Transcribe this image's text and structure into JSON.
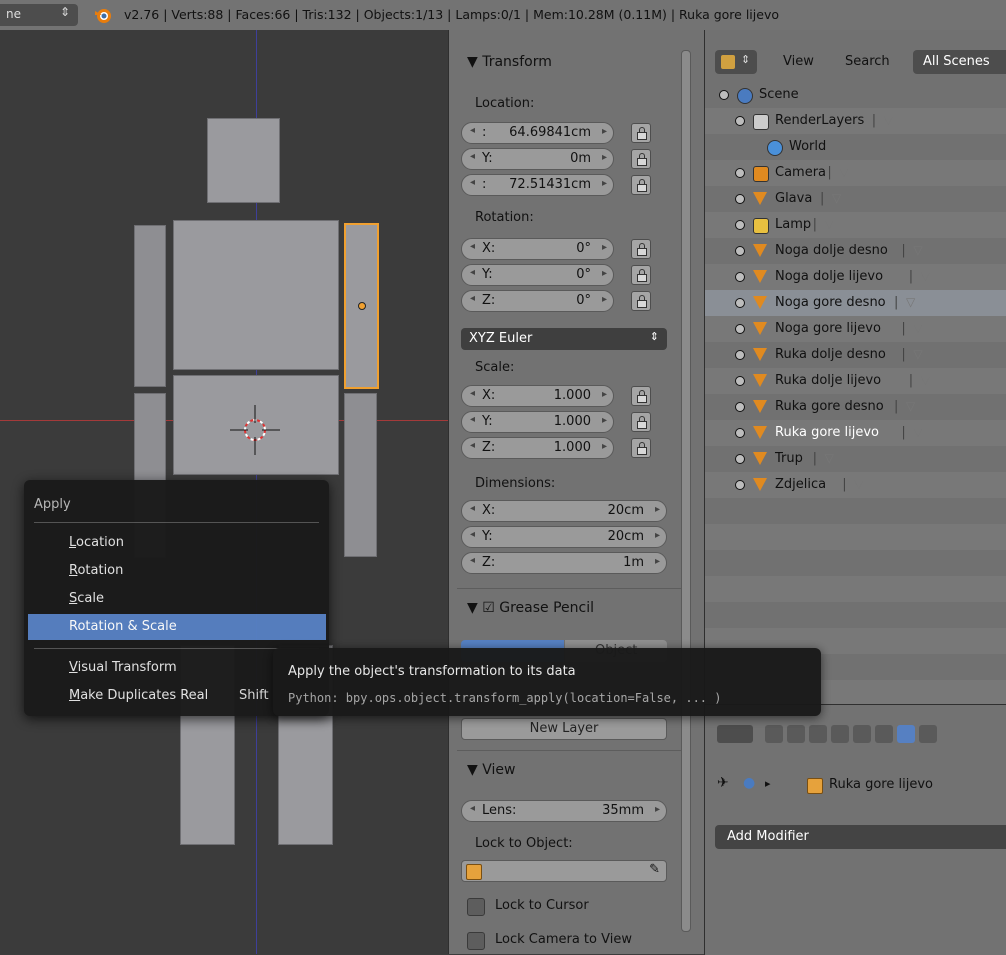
{
  "header": {
    "scene_selector": "ne",
    "stats": "v2.76 | Verts:88 | Faces:66 | Tris:132 | Objects:1/13 | Lamps:0/1 | Mem:10.28M (0.11M) | Ruka gore lijevo"
  },
  "apply_menu": {
    "title": "Apply",
    "items": [
      {
        "label_u": "L",
        "label_rest": "ocation"
      },
      {
        "label_u": "R",
        "label_rest": "otation"
      },
      {
        "label_u": "S",
        "label_rest": "cale"
      },
      {
        "label_u": "",
        "label_rest": "Rotation & Scale"
      },
      {
        "label_u": "V",
        "label_rest": "isual Transform"
      },
      {
        "label_u": "M",
        "label_rest": "ake Duplicates Real",
        "shortcut": "Shift"
      }
    ]
  },
  "tooltip": {
    "title": "Apply the object's transformation to its data",
    "python": "Python: bpy.ops.object.transform_apply(location=False, ... )"
  },
  "transform_panel": {
    "title": "Transform",
    "location_label": "Location:",
    "location": [
      {
        "axis": ":",
        "value": "64.69841cm"
      },
      {
        "axis": "Y:",
        "value": "0m"
      },
      {
        "axis": ":",
        "value": "72.51431cm"
      }
    ],
    "rotation_label": "Rotation:",
    "rotation": [
      {
        "axis": "X:",
        "value": "0°"
      },
      {
        "axis": "Y:",
        "value": "0°"
      },
      {
        "axis": "Z:",
        "value": "0°"
      }
    ],
    "rotation_mode": "XYZ Euler",
    "scale_label": "Scale:",
    "scale": [
      {
        "axis": "X:",
        "value": "1.000"
      },
      {
        "axis": "Y:",
        "value": "1.000"
      },
      {
        "axis": "Z:",
        "value": "1.000"
      }
    ],
    "dimensions_label": "Dimensions:",
    "dimensions": [
      {
        "axis": "X:",
        "value": "20cm"
      },
      {
        "axis": "Y:",
        "value": "20cm"
      },
      {
        "axis": "Z:",
        "value": "1m"
      }
    ]
  },
  "grease_pencil_panel": {
    "title": "Grease Pencil",
    "tab_right": "Object",
    "new_layer": "New Layer"
  },
  "view_panel": {
    "title": "View",
    "lens_label": "Lens:",
    "lens_value": "35mm",
    "lock_to_object_label": "Lock to Object:",
    "lock_to_cursor": "Lock to Cursor",
    "lock_camera_to_view": "Lock Camera to View"
  },
  "outliner": {
    "tabs": [
      "View",
      "Search"
    ],
    "display_mode": "All Scenes",
    "rows": [
      {
        "name": "Scene",
        "icon": "scene-icon"
      },
      {
        "name": "RenderLayers",
        "icon": "renderlayers-icon"
      },
      {
        "name": "World",
        "icon": "world-icon"
      },
      {
        "name": "Camera",
        "icon": "camera-icon"
      },
      {
        "name": "Glava",
        "icon": "mesh-object-icon"
      },
      {
        "name": "Lamp",
        "icon": "lamp-icon"
      },
      {
        "name": "Noga dolje desno",
        "icon": "mesh-object-icon"
      },
      {
        "name": "Noga dolje lijevo",
        "icon": "mesh-object-icon"
      },
      {
        "name": "Noga gore desno",
        "icon": "mesh-object-icon"
      },
      {
        "name": "Noga gore lijevo",
        "icon": "mesh-object-icon"
      },
      {
        "name": "Ruka dolje desno",
        "icon": "mesh-object-icon"
      },
      {
        "name": "Ruka dolje lijevo",
        "icon": "mesh-object-icon"
      },
      {
        "name": "Ruka gore desno",
        "icon": "mesh-object-icon"
      },
      {
        "name": "Ruka gore lijevo",
        "icon": "mesh-object-icon"
      },
      {
        "name": "Trup",
        "icon": "mesh-object-icon"
      },
      {
        "name": "Zdjelica",
        "icon": "mesh-object-icon"
      }
    ]
  },
  "properties_editor": {
    "object_name": "Ruka gore lijevo",
    "add_modifier": "Add Modifier"
  },
  "colors": {
    "selection_orange": "#f0a030",
    "menu_highlight": "#5680c2",
    "panel_gray": "#727272",
    "viewport_gray": "#3b3b3b"
  }
}
